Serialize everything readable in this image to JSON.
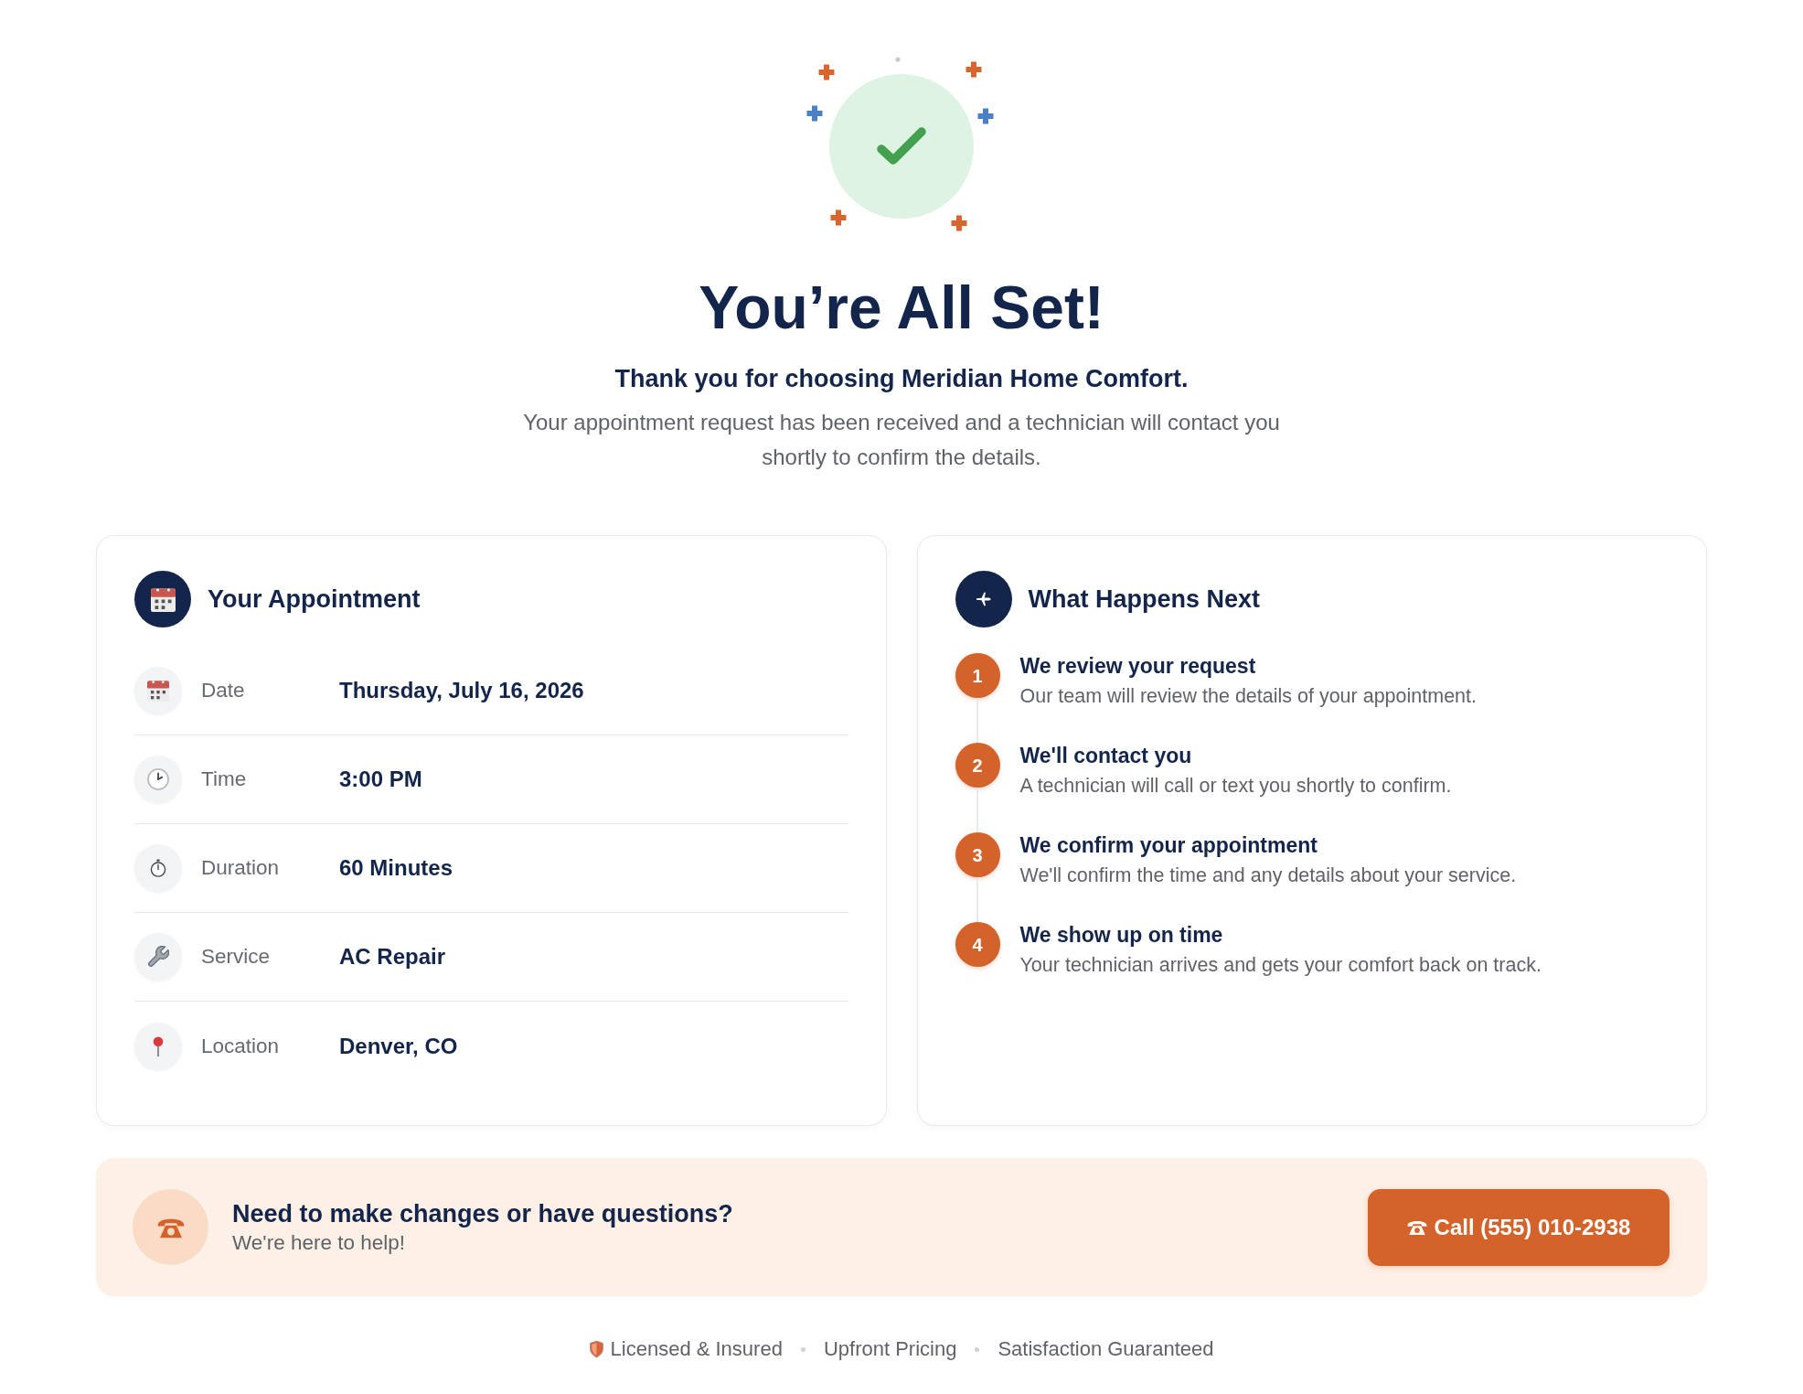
{
  "hero": {
    "title": "You’re All Set!",
    "subtitle": "Thank you for choosing Meridian Home Comfort.",
    "message": "Your appointment request has been received and a technician will contact you shortly to confirm the details."
  },
  "appointment": {
    "title": "Your Appointment",
    "rows": [
      {
        "label": "Date",
        "value": "Thursday, July 16, 2026"
      },
      {
        "label": "Time",
        "value": "3:00 PM"
      },
      {
        "label": "Duration",
        "value": "60 Minutes"
      },
      {
        "label": "Service",
        "value": "AC Repair"
      },
      {
        "label": "Location",
        "value": "Denver, CO"
      }
    ]
  },
  "next_steps": {
    "title": "What Happens Next",
    "steps": [
      {
        "number": "1",
        "title": "We review your request",
        "description": "Our team will review the details of your appointment."
      },
      {
        "number": "2",
        "title": "We'll contact you",
        "description": "A technician will call or text you shortly to confirm."
      },
      {
        "number": "3",
        "title": "We confirm your appointment",
        "description": "We'll confirm the time and any details about your service."
      },
      {
        "number": "4",
        "title": "We show up on time",
        "description": "Your technician arrives and gets your comfort back on track."
      }
    ]
  },
  "help_banner": {
    "title": "Need to make changes or have questions?",
    "subtitle": "We're here to help!",
    "button": "Call (555) 010-2938"
  },
  "footer": {
    "badges": [
      {
        "kind": "icon",
        "text": "Licensed & Insured"
      },
      {
        "kind": "text",
        "text": "Upfront Pricing"
      },
      {
        "kind": "text",
        "text": "Satisfaction Guaranteed"
      }
    ]
  }
}
